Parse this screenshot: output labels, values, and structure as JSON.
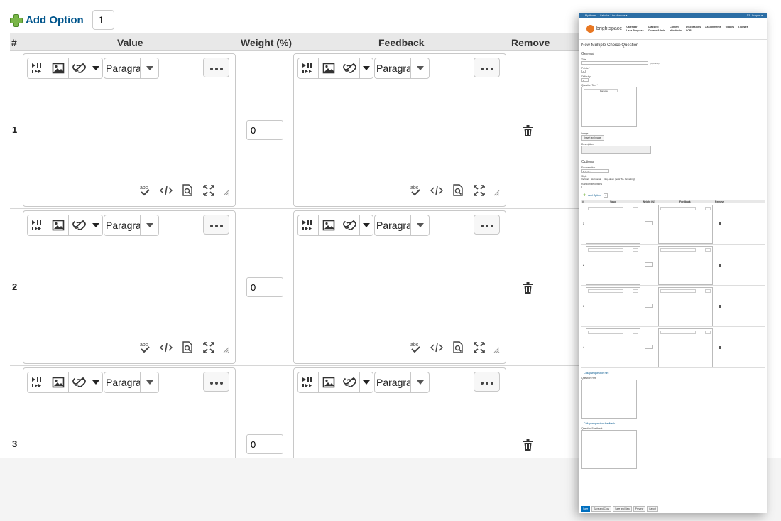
{
  "add": {
    "label": "Add Option",
    "count": "1"
  },
  "table": {
    "headers": {
      "num": "#",
      "value": "Value",
      "weight": "Weight (%)",
      "feedback": "Feedback",
      "remove": "Remove"
    },
    "rows": [
      {
        "num": "1",
        "weight": "0"
      },
      {
        "num": "2",
        "weight": "0"
      },
      {
        "num": "3",
        "weight": "0"
      }
    ]
  },
  "editor": {
    "format_select": "Paragra",
    "toolbar_icons": [
      "insert-stuff-icon",
      "insert-image-icon",
      "insert-quicklink-icon",
      "dropdown-arrow-icon"
    ],
    "footer_icons": [
      "spellcheck-icon",
      "source-code-icon",
      "preview-icon",
      "fullscreen-icon",
      "resize-grip-icon"
    ]
  },
  "thumbnail": {
    "topbar": {
      "home": "My Home",
      "course": "Calculus 1 for Honours ▾",
      "user": "D2L Support ▾"
    },
    "brand": {
      "name": "brightspace",
      "by": "by D2L"
    },
    "nav": [
      "Calendar",
      "Classlist",
      "Content",
      "Discussions",
      "Assignments",
      "Grades",
      "Quizzes",
      "User Progress",
      "Course Admin",
      "ePortfolio",
      "LOR"
    ],
    "page_title": "New Multiple Choice Question",
    "general": "General",
    "title_label": "Title",
    "optional": "(optional)",
    "points_label": "Points *",
    "points_value": "1",
    "difficulty_label": "Difficulty",
    "difficulty_value": "1",
    "question_text_label": "Question Text *",
    "image_label": "Image",
    "insert_image": "Insert an Image",
    "description_label": "Description",
    "options": "Options",
    "enumeration_label": "Enumeration",
    "enumeration_value": "a, b, c...",
    "style_label": "Style",
    "style_options": [
      "Vertical",
      "Horizontal",
      "Drop-down (no HTML formatting)"
    ],
    "randomize_label": "Randomize options",
    "add_option": "Add Option",
    "add_count": "1",
    "table_headers": [
      "#",
      "Value",
      "Weight (%)",
      "Feedback",
      "Remove"
    ],
    "rows": [
      "1",
      "2",
      "3",
      "4"
    ],
    "collapse_hint": "Collapse question hint",
    "hint_label": "Question Hint",
    "collapse_feedback": "Collapse question feedback",
    "feedback_label": "Question Feedback",
    "actions": [
      "Save",
      "Save and Copy",
      "Save and New",
      "Preview",
      "Cancel"
    ],
    "format_select": "Paragra"
  }
}
